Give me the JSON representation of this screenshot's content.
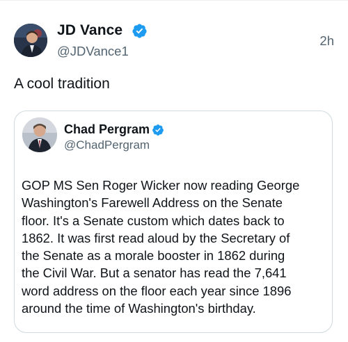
{
  "author": {
    "name": "JD Vance",
    "handle": "@JDVance1",
    "time": "2h"
  },
  "tweet": {
    "text": "A cool tradition"
  },
  "quoted": {
    "name": "Chad Pergram",
    "handle": "@ChadPergram",
    "text": "GOP MS Sen Roger Wicker now reading George\nWashington's Farewell Address on the Senate\nfloor. It's a Senate custom which dates back to\n1862. It was first read aloud by the Secretary of\nthe Senate as a morale booster in 1862 during\nthe Civil War. But a senator has read the 7,641\nword address on the floor each year since 1896\naround the time of Washington's birthday."
  },
  "colors": {
    "verified_badge": "#1d9bf0",
    "secondary_text": "#536471",
    "border": "#cfd9de"
  }
}
